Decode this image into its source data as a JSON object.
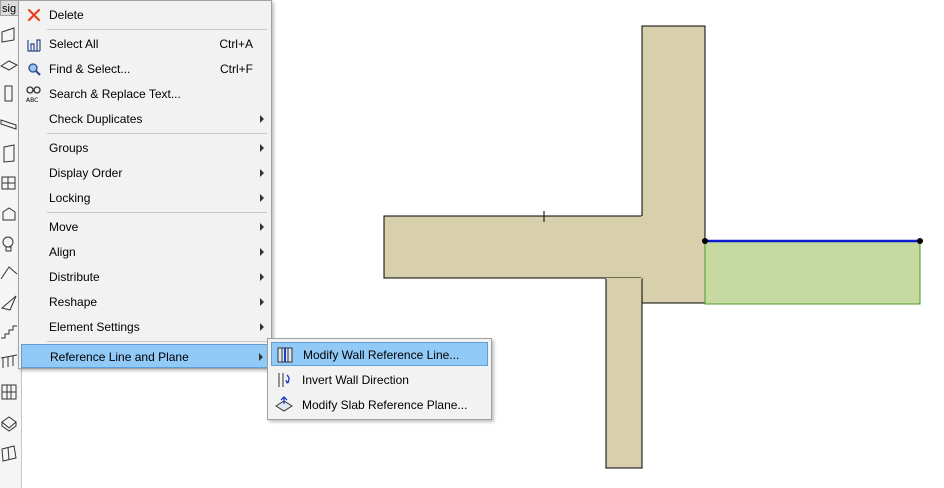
{
  "toolbox": {
    "label": "sig",
    "tools": [
      "wall-tool-icon",
      "slab-tool-icon",
      "column-tool-icon",
      "beam-tool-icon",
      "door-tool-icon",
      "window-tool-icon",
      "object-tool-icon",
      "lamp-tool-icon",
      "roof-tool-icon",
      "shell-tool-icon",
      "stair-tool-icon",
      "railing-tool-icon",
      "curtain-wall-tool-icon",
      "morph-tool-icon",
      "mesh-tool-icon"
    ]
  },
  "context_menu": {
    "items": [
      {
        "label": "Delete",
        "icon": "delete-icon"
      },
      {
        "label": "Select All",
        "shortcut": "Ctrl+A",
        "icon": "select-all-icon"
      },
      {
        "label": "Find & Select...",
        "shortcut": "Ctrl+F",
        "icon": "find-select-icon"
      },
      {
        "label": "Search & Replace Text...",
        "icon": "search-replace-icon"
      },
      {
        "label": "Check Duplicates",
        "submenu": true
      },
      {
        "label": "Groups",
        "submenu": true
      },
      {
        "label": "Display Order",
        "submenu": true
      },
      {
        "label": "Locking",
        "submenu": true
      },
      {
        "label": "Move",
        "submenu": true
      },
      {
        "label": "Align",
        "submenu": true
      },
      {
        "label": "Distribute",
        "submenu": true
      },
      {
        "label": "Reshape",
        "submenu": true
      },
      {
        "label": "Element Settings",
        "submenu": true
      },
      {
        "label": "Reference Line and Plane",
        "submenu": true,
        "highlighted": true
      }
    ]
  },
  "submenu": {
    "items": [
      {
        "label": "Modify Wall Reference Line...",
        "icon": "modify-wall-reference-line-icon",
        "highlighted": true
      },
      {
        "label": "Invert Wall Direction",
        "icon": "invert-wall-direction-icon"
      },
      {
        "label": "Modify Slab Reference Plane...",
        "icon": "modify-slab-reference-plane-icon"
      }
    ]
  },
  "colors": {
    "wall_fill": "#d8d0ac",
    "selected_wall_fill": "#c6d9a0",
    "reference_line": "#0a1ecc",
    "menu_background": "#f2f2f2",
    "menu_highlight": "#91c9f7",
    "delete_icon": "#e8401c"
  }
}
